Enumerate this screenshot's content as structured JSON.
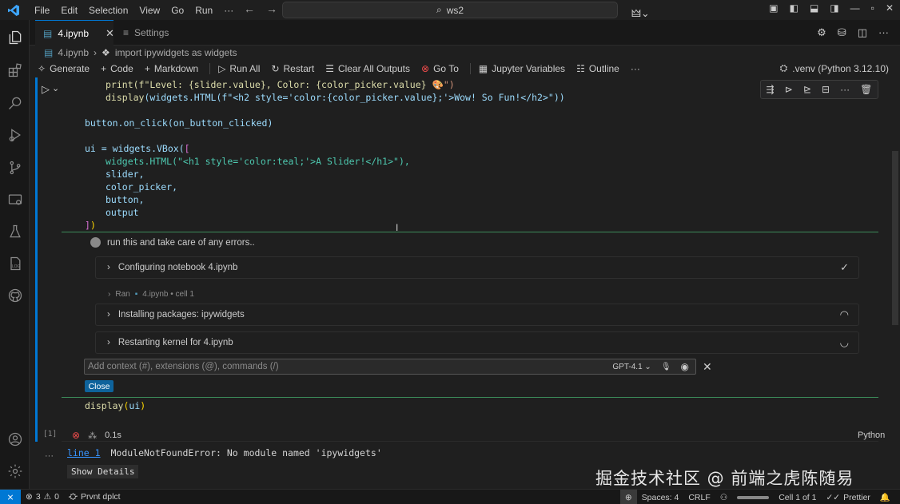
{
  "menu": [
    "File",
    "Edit",
    "Selection",
    "View",
    "Go",
    "Run",
    "···"
  ],
  "search": {
    "text": "ws2"
  },
  "tabs": [
    {
      "label": "4.ipynb",
      "close": "✕"
    },
    {
      "label": "Settings"
    }
  ],
  "breadcrumb": {
    "file": "4.ipynb",
    "symbol": "import ipywidgets as widgets"
  },
  "toolbar": {
    "generate": "Generate",
    "code": "Code",
    "markdown": "Markdown",
    "run_all": "Run All",
    "restart": "Restart",
    "clear_outputs": "Clear All Outputs",
    "go_to": "Go To",
    "jupyter_vars": "Jupyter Variables",
    "outline": "Outline",
    "more": "···",
    "kernel": ".venv (Python 3.12.10)"
  },
  "code_lines": {
    "l1a": "print(f\"Level: {slider.value}, Color: {color_picker.value} ",
    "l1emoji": "🎨",
    "l1b": "\")",
    "l2a": "display",
    "l2b": "(widgets.HTML(f\"<h2 style='color:{color_picker.value};'>Wow! So Fun!</h2>\"))",
    "l3": "button.on_click(on_button_clicked)",
    "l4a": "ui = widgets.VBox(",
    "l4b": "[",
    "l5": "widgets.HTML(\"<h1 style='color:teal;'>A Slider!</h1>\"),",
    "l6": "slider,",
    "l7": "color_picker,",
    "l8": "button,",
    "l9": "output",
    "l10a": "]",
    "l10b": ")",
    "l11a": "display",
    "l11b": "(",
    "l11c": "ui",
    "l11d": ")"
  },
  "chat": {
    "prompt": "run this and take care of any errors..",
    "step1": "Configuring notebook 4.ipynb",
    "ran_label": "Ran",
    "ran_target": "4.ipynb • cell 1",
    "step2": "Installing packages: ipywidgets",
    "step3": "Restarting kernel for 4.ipynb",
    "input_placeholder": "Add context (#), extensions (@), commands (/)",
    "model": "GPT-4.1",
    "close": "Close"
  },
  "cell": {
    "exec_count": "[1]",
    "duration": "0.1s",
    "language": "Python"
  },
  "output": {
    "link": "line 1",
    "error": "ModuleNotFoundError: No module named 'ipywidgets'",
    "details": "Show Details"
  },
  "watermark": "掘金技术社区 @ 前端之虎陈随易",
  "status": {
    "errors": "3",
    "warnings": "0",
    "extension": "Prvnt dplct",
    "spaces": "Spaces: 4",
    "eol": "CRLF",
    "cell_pos": "Cell 1 of 1",
    "prettier": "Prettier"
  },
  "colors": {
    "accent": "#0078d4",
    "error": "#f14c4c",
    "chat_border": "#3c8c5a"
  }
}
